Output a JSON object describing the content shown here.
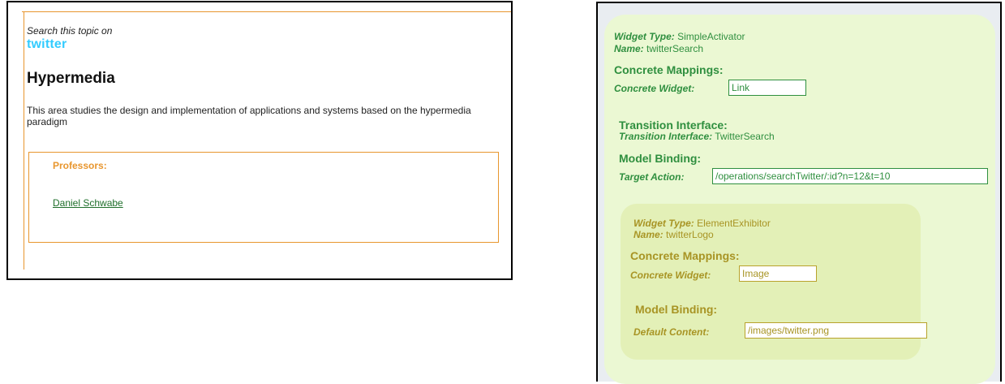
{
  "left": {
    "search_text": "Search this topic on",
    "twitter_logo": "twitter",
    "title": "Hypermedia",
    "description": "This area studies the design and implementation of applications and systems based on the hypermedia paradigm",
    "professors_label": "Professors:",
    "professor_name": "Daniel Schwabe"
  },
  "right": {
    "widget_type_label": "Widget Type:",
    "widget_type_value": "SimpleActivator",
    "name_label": "Name:",
    "name_value": "twitterSearch",
    "concrete_mappings_heading": "Concrete Mappings:",
    "concrete_widget_label": "Concrete Widget:",
    "concrete_widget_value": "Link",
    "transition_heading": "Transition Interface:",
    "transition_label": "Transition Interface:",
    "transition_value": "TwitterSearch",
    "model_binding_heading": "Model Binding:",
    "target_action_label": "Target Action:",
    "target_action_value": "/operations/searchTwitter/:id?n=12&t=10",
    "inner": {
      "widget_type_label": "Widget Type:",
      "widget_type_value": "ElementExhibitor",
      "name_label": "Name:",
      "name_value": "twitterLogo",
      "concrete_mappings_heading": "Concrete Mappings:",
      "concrete_widget_label": "Concrete Widget:",
      "concrete_widget_value": "Image",
      "model_binding_heading": "Model Binding:",
      "default_content_label": "Default Content:",
      "default_content_value": "/images/twitter.png"
    }
  },
  "colors": {
    "orange": "#e8962e",
    "green": "#2f8f3f",
    "olive": "#a89424",
    "twitter_blue": "#33ccff"
  }
}
